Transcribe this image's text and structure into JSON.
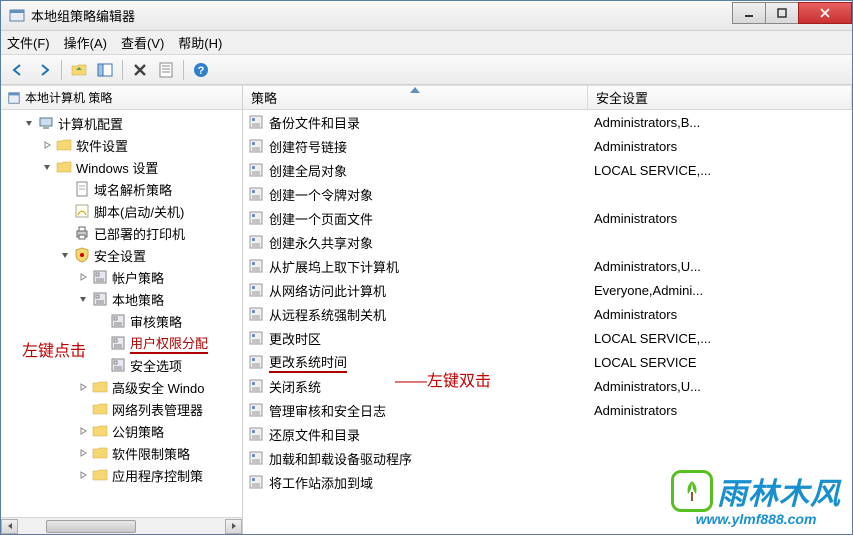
{
  "window": {
    "title": "本地组策略编辑器"
  },
  "menu": {
    "file": "文件(F)",
    "action": "操作(A)",
    "view": "查看(V)",
    "help": "帮助(H)"
  },
  "tree": {
    "header": "本地计算机 策略",
    "nodes": [
      {
        "indent": 1,
        "exp": "open",
        "icon": "computer",
        "label": "计算机配置"
      },
      {
        "indent": 2,
        "exp": "closed",
        "icon": "folder",
        "label": "软件设置"
      },
      {
        "indent": 2,
        "exp": "open",
        "icon": "folder",
        "label": "Windows 设置"
      },
      {
        "indent": 3,
        "exp": "none",
        "icon": "doc",
        "label": "域名解析策略"
      },
      {
        "indent": 3,
        "exp": "none",
        "icon": "script",
        "label": "脚本(启动/关机)"
      },
      {
        "indent": 3,
        "exp": "none",
        "icon": "printer",
        "label": "已部署的打印机"
      },
      {
        "indent": 3,
        "exp": "open",
        "icon": "shield",
        "label": "安全设置"
      },
      {
        "indent": 4,
        "exp": "closed",
        "icon": "policy",
        "label": "帐户策略"
      },
      {
        "indent": 4,
        "exp": "open",
        "icon": "policy",
        "label": "本地策略"
      },
      {
        "indent": 5,
        "exp": "none",
        "icon": "policy",
        "label": "审核策略"
      },
      {
        "indent": 5,
        "exp": "none",
        "icon": "policy",
        "label": "用户权限分配",
        "selected": true
      },
      {
        "indent": 5,
        "exp": "none",
        "icon": "policy",
        "label": "安全选项"
      },
      {
        "indent": 4,
        "exp": "closed",
        "icon": "folder",
        "label": "高级安全 Windo"
      },
      {
        "indent": 4,
        "exp": "none",
        "icon": "folder",
        "label": "网络列表管理器"
      },
      {
        "indent": 4,
        "exp": "closed",
        "icon": "folder",
        "label": "公钥策略"
      },
      {
        "indent": 4,
        "exp": "closed",
        "icon": "folder",
        "label": "软件限制策略"
      },
      {
        "indent": 4,
        "exp": "closed",
        "icon": "folder",
        "label": "应用程序控制策"
      }
    ]
  },
  "list": {
    "columns": {
      "policy": "策略",
      "security": "安全设置"
    },
    "rows": [
      {
        "policy": "备份文件和目录",
        "security": "Administrators,B..."
      },
      {
        "policy": "创建符号链接",
        "security": "Administrators"
      },
      {
        "policy": "创建全局对象",
        "security": "LOCAL SERVICE,..."
      },
      {
        "policy": "创建一个令牌对象",
        "security": ""
      },
      {
        "policy": "创建一个页面文件",
        "security": "Administrators"
      },
      {
        "policy": "创建永久共享对象",
        "security": ""
      },
      {
        "policy": "从扩展坞上取下计算机",
        "security": "Administrators,U..."
      },
      {
        "policy": "从网络访问此计算机",
        "security": "Everyone,Admini..."
      },
      {
        "policy": "从远程系统强制关机",
        "security": "Administrators"
      },
      {
        "policy": "更改时区",
        "security": "LOCAL SERVICE,..."
      },
      {
        "policy": "更改系统时间",
        "security": "LOCAL SERVICE",
        "marked": true
      },
      {
        "policy": "关闭系统",
        "security": "Administrators,U..."
      },
      {
        "policy": "管理审核和安全日志",
        "security": "Administrators"
      },
      {
        "policy": "还原文件和目录",
        "security": ""
      },
      {
        "policy": "加载和卸载设备驱动程序",
        "security": ""
      },
      {
        "policy": "将工作站添加到域",
        "security": ""
      }
    ]
  },
  "annotations": {
    "left_click": "左键点击",
    "double_click": "——左键双击"
  },
  "watermark": {
    "brand": "雨林木风",
    "url": "www.ylmf888.com"
  }
}
